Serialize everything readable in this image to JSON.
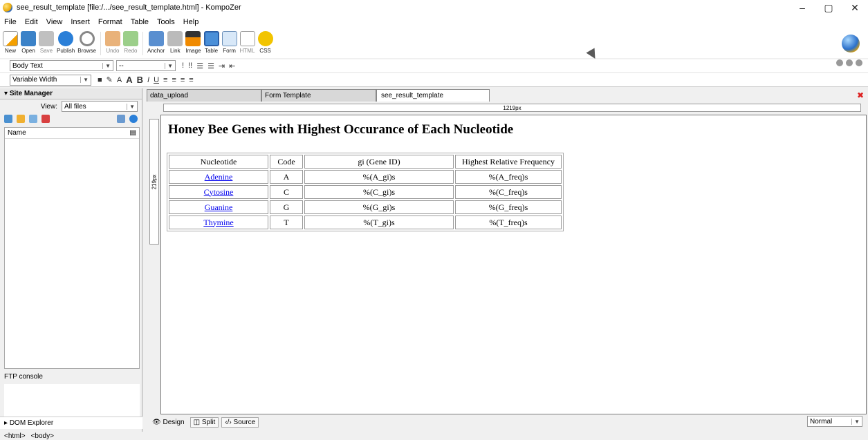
{
  "window": {
    "title": "see_result_template [file:/.../see_result_template.html] - KompoZer",
    "controls": [
      "–",
      "▢",
      "✕"
    ]
  },
  "menu": [
    "File",
    "Edit",
    "View",
    "Insert",
    "Format",
    "Table",
    "Tools",
    "Help"
  ],
  "toolbar": {
    "items": [
      {
        "label": "New"
      },
      {
        "label": "Open"
      },
      {
        "label": "Save"
      },
      {
        "label": "Publish"
      },
      {
        "label": "Browse"
      },
      {
        "label": "Undo"
      },
      {
        "label": "Redo"
      },
      {
        "label": "Anchor"
      },
      {
        "label": "Link"
      },
      {
        "label": "Image"
      },
      {
        "label": "Table"
      },
      {
        "label": "Form"
      },
      {
        "label": "HTML"
      },
      {
        "label": "CSS"
      }
    ]
  },
  "format1": {
    "paragraph_style": "Body Text",
    "second_select": "--"
  },
  "format2": {
    "width_mode": "Variable Width"
  },
  "site_manager": {
    "header": "Site Manager",
    "view_label": "View:",
    "view_value": "All files",
    "col_name": "Name",
    "ftp_header": "FTP console",
    "dom_explorer": "DOM Explorer"
  },
  "tabs": [
    {
      "label": "data_upload"
    },
    {
      "label": "Form Template"
    },
    {
      "label": "see_result_template",
      "active": true
    }
  ],
  "rulers": {
    "horizontal": "1219px",
    "vertical": "219px"
  },
  "document": {
    "title": "Honey Bee Genes with Highest Occurance of Each Nucleotide",
    "headers": [
      "Nucleotide",
      "Code",
      "gi (Gene ID)",
      "Highest Relative Frequency"
    ],
    "rows": [
      {
        "name": "Adenine",
        "code": "A",
        "gi": "%(A_gi)s",
        "freq": "%(A_freq)s"
      },
      {
        "name": "Cytosine",
        "code": "C",
        "gi": "%(C_gi)s",
        "freq": "%(C_freq)s"
      },
      {
        "name": "Guanine",
        "code": "G",
        "gi": "%(G_gi)s",
        "freq": "%(G_freq)s"
      },
      {
        "name": "Thymine",
        "code": "T",
        "gi": "%(T_gi)s",
        "freq": "%(T_freq)s"
      }
    ]
  },
  "view_modes": {
    "design": "Design",
    "split": "Split",
    "source": "Source"
  },
  "zoom": "Normal",
  "status": {
    "tags": [
      "<html>",
      "<body>"
    ]
  }
}
